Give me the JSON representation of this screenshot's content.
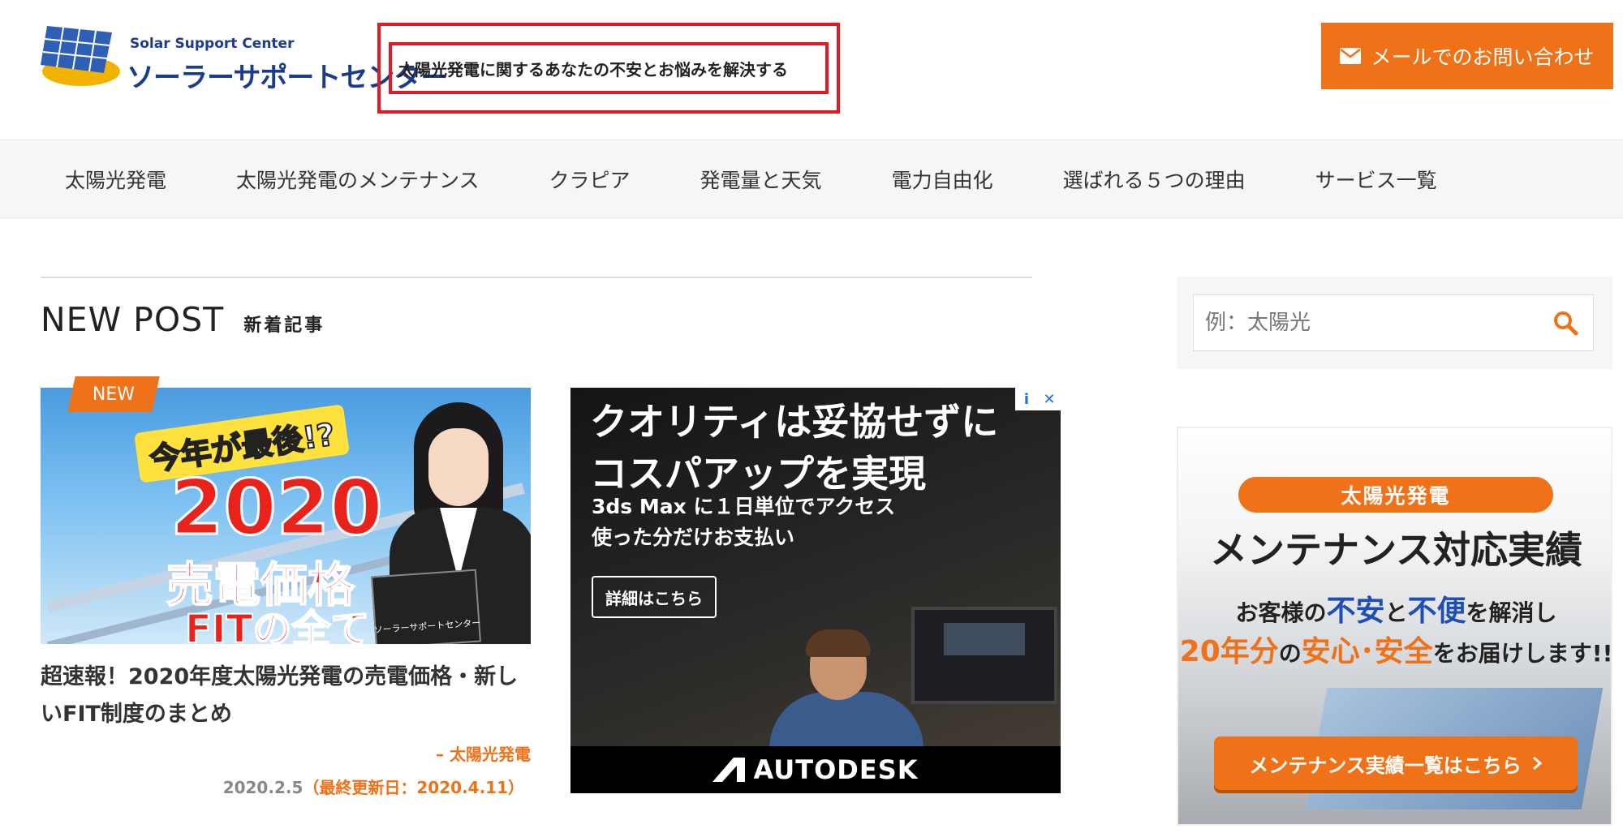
{
  "header": {
    "logo_en": "Solar Support Center",
    "logo_jp": "ソーラーサポートセンター",
    "tagline": "太陽光発電に関するあなたの不安とお悩みを解決する",
    "mail_button": "メールでのお問い合わせ"
  },
  "nav": {
    "items": [
      {
        "label": "太陽光発電"
      },
      {
        "label": "太陽光発電のメンテナンス"
      },
      {
        "label": "クラピア"
      },
      {
        "label": "発電量と天気"
      },
      {
        "label": "電力自由化"
      },
      {
        "label": "選ばれる５つの理由"
      },
      {
        "label": "サービス一覧"
      }
    ]
  },
  "main": {
    "section_en": "NEW POST",
    "section_jp": "新着記事",
    "card": {
      "badge": "NEW",
      "image_banner": "今年が最後!?",
      "image_year": "2020",
      "image_price": "売電価格",
      "image_fit": "FITの全て",
      "image_card": "ソーラーサポートセンター",
      "title": "超速報！2020年度太陽光発電の売電価格・新しいFIT制度のまとめ",
      "category": "– 太陽光発電",
      "date": "2020.2.5",
      "updated": "（最終更新日：2020.4.11）"
    }
  },
  "ad": {
    "headline_1": "クオリティは妥協せずに",
    "headline_2": "コスパアップを実現",
    "sub_1": "3ds Max に１日単位でアクセス",
    "sub_2": "使った分だけお支払い",
    "button": "詳細はこちら",
    "brand": "AUTODESK",
    "info_icon": "i",
    "close_icon": "✕"
  },
  "sidebar": {
    "search_placeholder": "例：太陽光",
    "banner": {
      "pill": "太陽光発電",
      "headline": "メンテナンス対応実績",
      "line1_a": "お客様の",
      "line1_b": "不安",
      "line1_c": "と",
      "line1_d": "不便",
      "line1_e": "を解消し",
      "line2_a": "20年分",
      "line2_b": "の",
      "line2_c": "安心･安全",
      "line2_d": "をお届けします!!",
      "button": "メンテナンス実績一覧はこちら"
    }
  },
  "colors": {
    "accent": "#ef7118",
    "highlight_border": "#e01b24",
    "brand_blue": "#1a3c8c"
  }
}
